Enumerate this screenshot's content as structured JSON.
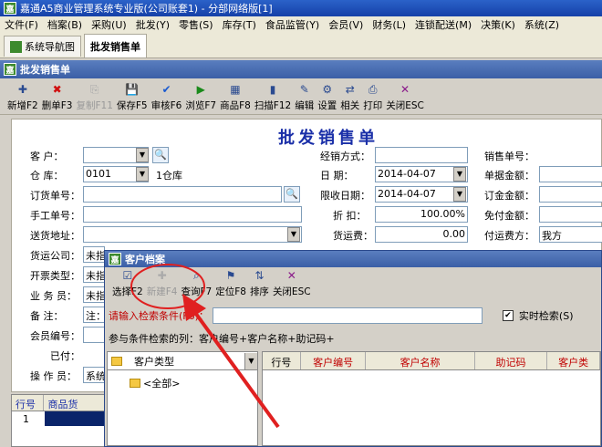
{
  "window": {
    "title": "嘉通A5商业管理系统专业版(公司账套1) - 分部网络版[1]",
    "icon": "app-logo-icon"
  },
  "menu": [
    "文件(F)",
    "档案(B)",
    "采购(U)",
    "批发(Y)",
    "零售(S)",
    "库存(T)",
    "食品监管(Y)",
    "会员(V)",
    "财务(L)",
    "连锁配送(M)",
    "决策(K)",
    "系统(Z)"
  ],
  "tabs": [
    {
      "label": "系统导航图",
      "active": false
    },
    {
      "label": "批发销售单",
      "active": true
    }
  ],
  "subwindow": {
    "title": "批发销售单"
  },
  "toolbar": [
    {
      "label": "新增F2",
      "icon": "new-icon",
      "enabled": true
    },
    {
      "label": "删单F3",
      "icon": "delete-icon",
      "enabled": true
    },
    {
      "label": "复制F11",
      "icon": "copy-icon",
      "enabled": false
    },
    {
      "label": "保存F5",
      "icon": "save-icon",
      "enabled": true
    },
    {
      "label": "审核F6",
      "icon": "audit-icon",
      "enabled": true
    },
    {
      "label": "浏览F7",
      "icon": "browse-icon",
      "enabled": true
    },
    {
      "label": "商品F8",
      "icon": "goods-icon",
      "enabled": true
    },
    {
      "label": "扫描F12",
      "icon": "barcode-icon",
      "enabled": true
    },
    {
      "label": "编辑",
      "icon": "edit-icon",
      "enabled": true
    },
    {
      "label": "设置",
      "icon": "settings-icon",
      "enabled": true
    },
    {
      "label": "相关",
      "icon": "related-icon",
      "enabled": true
    },
    {
      "label": "打印",
      "icon": "print-icon",
      "enabled": true
    },
    {
      "label": "关闭ESC",
      "icon": "close-icon",
      "enabled": true
    }
  ],
  "form": {
    "title": "批发销售单",
    "customer_label": "客    户：",
    "warehouse_label": "仓    库：",
    "warehouse_code": "0101",
    "warehouse_name": "1仓库",
    "order_no_label": "订货单号：",
    "manual_no_label": "手工单号：",
    "address_label": "送货地址：",
    "carrier_label": "货运公司：",
    "carrier_value": "未指",
    "invoice_label": "开票类型：",
    "invoice_value": "未指",
    "salesman_label": "业 务 员：",
    "salesman_value": "未指",
    "remark_label": "备    注：",
    "remark_value": "注：",
    "member_label": "会员编号：",
    "paid_label": "已付：",
    "operator_label": "操 作 员：",
    "operator_value": "系统",
    "settle_label": "经销方式：",
    "date_label": "日    期：",
    "date_value": "2014-04-07",
    "due_label": "限收日期：",
    "due_value": "2014-04-07",
    "discount_label": "折    扣：",
    "discount_value": "100.00%",
    "freight_label": "货运费：",
    "freight_value": "0.00",
    "sale_no_label": "销售单号：",
    "amount_label": "单据金额：",
    "order_amount_label": "订金金额：",
    "free_amount_label": "免付金额：",
    "freight_payer_label": "付运费方：",
    "freight_payer_value": "我方"
  },
  "grid": {
    "headers": [
      "行号",
      "商品货"
    ],
    "rows": [
      "1"
    ]
  },
  "dialog": {
    "title": "客户档案",
    "toolbar": [
      {
        "label": "选择F2",
        "icon": "select-icon",
        "enabled": true
      },
      {
        "label": "新建F4",
        "icon": "new-icon",
        "enabled": false
      },
      {
        "label": "查询F7",
        "icon": "search-icon",
        "enabled": true
      },
      {
        "label": "定位F8",
        "icon": "locate-icon",
        "enabled": true
      },
      {
        "label": "排序",
        "icon": "sort-icon",
        "enabled": true
      },
      {
        "label": "关闭ESC",
        "icon": "close-icon",
        "enabled": true
      }
    ],
    "search_label": "请输入检索条件(F6)：",
    "realtime_label": "实时检索(S)",
    "realtime_checked": true,
    "hint": "参与条件检索的列：客户编号+客户名称+助记码+",
    "tree_header": "客户类型",
    "tree_root": "<全部>",
    "list_headers": [
      "行号",
      "客户编号",
      "客户名称",
      "助记码",
      "客户类"
    ]
  },
  "colors": {
    "title_blue": "#1a2fa8",
    "red_label": "#c00000",
    "annotation": "#e02020"
  }
}
